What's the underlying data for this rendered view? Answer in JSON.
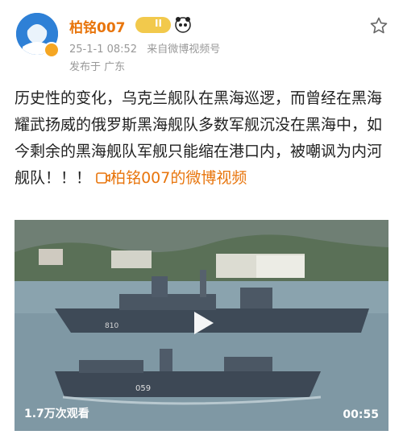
{
  "post": {
    "author": "柏铭007",
    "vip_level": "II",
    "timestamp": "25-1-1 08:52",
    "source": "来自微博视频号",
    "location": "发布于 广东",
    "text": "历史性的变化，乌克兰舰队在黑海巡逻，而曾经在黑海耀武扬威的俄罗斯黑海舰队多数军舰沉没在黑海中，如今剩余的黑海舰队军舰只能缩在港口内，被嘲讽为内河舰队！！！",
    "video_link": "柏铭007的微博视频"
  },
  "video": {
    "views": "1.7万次观看",
    "duration": "00:55",
    "hull_numbers": [
      "810",
      "059"
    ]
  },
  "icons": {
    "favorite": "star-outline-icon",
    "play": "play-icon",
    "video_link": "video-link-icon",
    "verified": "verified-badge-icon"
  },
  "colors": {
    "accent": "#e8750c",
    "meta": "#999999"
  }
}
